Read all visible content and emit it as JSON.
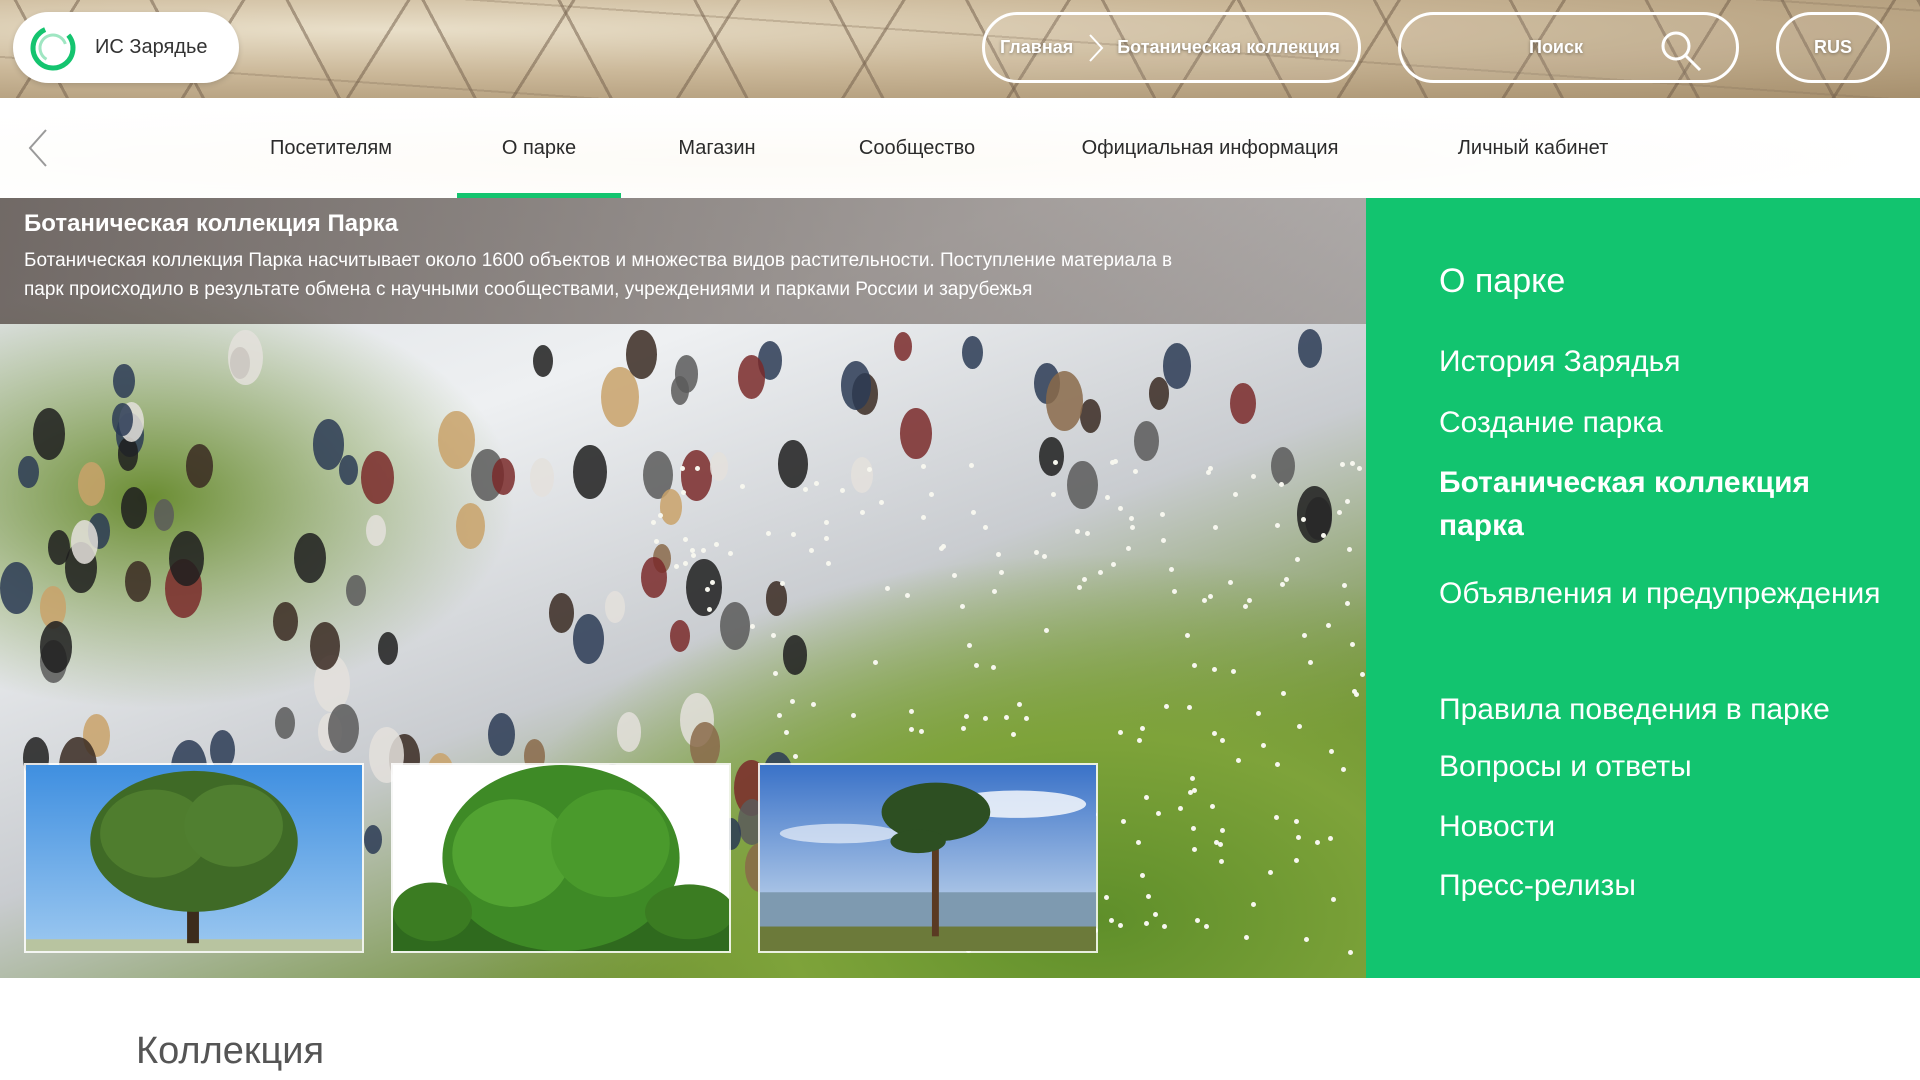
{
  "header": {
    "logo_text": "ИС Зарядье",
    "breadcrumb": [
      "Главная",
      "Ботаническая коллекция"
    ],
    "search_label": "Поиск",
    "language": "RUS"
  },
  "nav": {
    "items": [
      "Посетителям",
      "О парке",
      "Магазин",
      "Сообщество",
      "Официальная информация",
      "Личный кабинет"
    ],
    "active": "О парке"
  },
  "hero": {
    "title": "Ботаническая коллекция Парка",
    "description_line1": "Ботаническая коллекция Парка насчитывает около 1600 объектов и множества видов растительности. Поступление материала в",
    "description_line2": "парк происходило в результате обмена с научными сообществами, учреждениями и парками России и зарубежья"
  },
  "thumbnails": [
    "oak-tree-blue-sky",
    "oak-tree-white-background",
    "pine-tree-lake"
  ],
  "sidebar": {
    "title": "О парке",
    "items": [
      "История Зарядья",
      "Создание парка",
      "Ботаническая коллекция парка",
      "Объявления и предупреждения",
      "Правила поведения в парке",
      "Вопросы и ответы",
      "Новости",
      "Пресс-релизы"
    ],
    "active": "Ботаническая коллекция парка"
  },
  "section": {
    "title": "Коллекция"
  },
  "colors": {
    "accent": "#12c46f",
    "nav_underline": "#14c46f"
  }
}
